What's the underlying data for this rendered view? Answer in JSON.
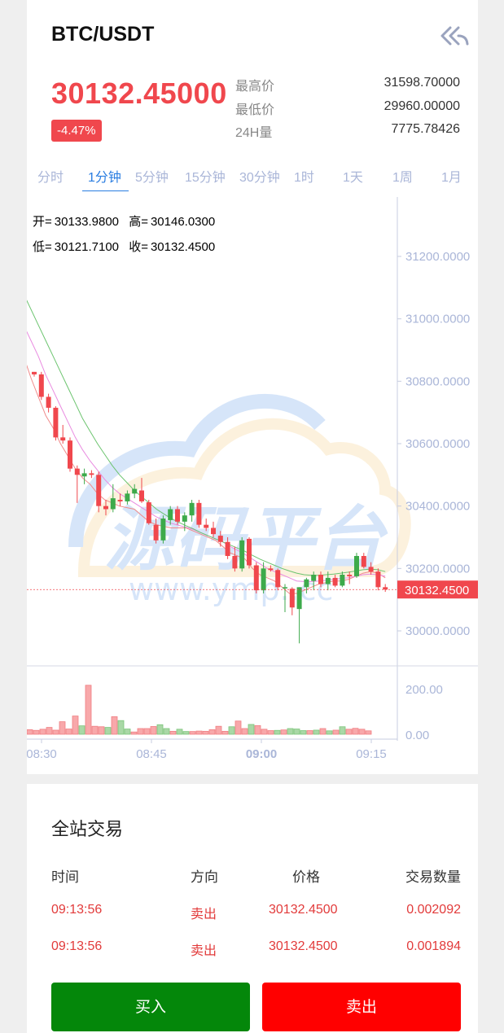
{
  "header": {
    "pair": "BTC/USDT",
    "back_icon": "double-chevron-back-icon"
  },
  "ticker": {
    "last_price": "30132.45000",
    "change": "-4.47%",
    "stats": [
      {
        "label": "最高价",
        "value": "31598.70000"
      },
      {
        "label": "最低价",
        "value": "29960.00000"
      },
      {
        "label": "24H量",
        "value": "7775.78426"
      }
    ]
  },
  "intervals": {
    "items": [
      "分时",
      "1分钟",
      "5分钟",
      "15分钟",
      "30分钟",
      "1时",
      "1天",
      "1周",
      "1月"
    ],
    "active": "1分钟"
  },
  "ohlc": {
    "open_label": "开=",
    "open": "30133.9800",
    "high_label": "高=",
    "high": "30146.0300",
    "low_label": "低=",
    "low": "30121.7100",
    "close_label": "收=",
    "close": "30132.4500"
  },
  "watermark": {
    "text": "源码平台",
    "url": "www.ymp..cc"
  },
  "colors": {
    "up": "#3daa4b",
    "down": "#f0474d",
    "accent": "#2a7de1",
    "buy": "#04870a",
    "sell": "#ff0000"
  },
  "chart_data": {
    "type": "candlestick",
    "y_ticks": [
      "31200.0000",
      "31000.0000",
      "30800.0000",
      "30600.0000",
      "30400.0000",
      "30200.0000",
      "30000.0000"
    ],
    "ylim": [
      29900,
      31380
    ],
    "last_price_label": "30132.4500",
    "last_price": 30132.45,
    "x_ticks": [
      "08:30",
      "08:45",
      "09:00",
      "09:15"
    ],
    "volume_ticks": [
      "200.00",
      "0.00"
    ],
    "volume_max": 260,
    "candles": [
      {
        "o": 30830,
        "h": 30830,
        "l": 30815,
        "c": 30822
      },
      {
        "o": 30822,
        "h": 30830,
        "l": 30740,
        "c": 30750
      },
      {
        "o": 30750,
        "h": 30760,
        "l": 30700,
        "c": 30715
      },
      {
        "o": 30715,
        "h": 30720,
        "l": 30610,
        "c": 30620
      },
      {
        "o": 30620,
        "h": 30660,
        "l": 30600,
        "c": 30610
      },
      {
        "o": 30610,
        "h": 30620,
        "l": 30510,
        "c": 30520
      },
      {
        "o": 30520,
        "h": 30530,
        "l": 30410,
        "c": 30500
      },
      {
        "o": 30495,
        "h": 30520,
        "l": 30470,
        "c": 30505
      },
      {
        "o": 30505,
        "h": 30515,
        "l": 30490,
        "c": 30500
      },
      {
        "o": 30500,
        "h": 30510,
        "l": 30380,
        "c": 30400
      },
      {
        "o": 30400,
        "h": 30420,
        "l": 30370,
        "c": 30390
      },
      {
        "o": 30390,
        "h": 30470,
        "l": 30380,
        "c": 30425
      },
      {
        "o": 30420,
        "h": 30440,
        "l": 30400,
        "c": 30415
      },
      {
        "o": 30415,
        "h": 30450,
        "l": 30405,
        "c": 30440
      },
      {
        "o": 30440,
        "h": 30470,
        "l": 30425,
        "c": 30455
      },
      {
        "o": 30450,
        "h": 30490,
        "l": 30410,
        "c": 30415
      },
      {
        "o": 30412,
        "h": 30420,
        "l": 30340,
        "c": 30345
      },
      {
        "o": 30340,
        "h": 30360,
        "l": 30280,
        "c": 30290
      },
      {
        "o": 30290,
        "h": 30370,
        "l": 30280,
        "c": 30360
      },
      {
        "o": 30355,
        "h": 30400,
        "l": 30340,
        "c": 30390
      },
      {
        "o": 30390,
        "h": 30400,
        "l": 30340,
        "c": 30350
      },
      {
        "o": 30350,
        "h": 30380,
        "l": 30320,
        "c": 30370
      },
      {
        "o": 30370,
        "h": 30420,
        "l": 30350,
        "c": 30410
      },
      {
        "o": 30410,
        "h": 30420,
        "l": 30330,
        "c": 30340
      },
      {
        "o": 30340,
        "h": 30360,
        "l": 30320,
        "c": 30330
      },
      {
        "o": 30330,
        "h": 30350,
        "l": 30300,
        "c": 30310
      },
      {
        "o": 30305,
        "h": 30320,
        "l": 30270,
        "c": 30285
      },
      {
        "o": 30285,
        "h": 30300,
        "l": 30230,
        "c": 30240
      },
      {
        "o": 30240,
        "h": 30270,
        "l": 30190,
        "c": 30200
      },
      {
        "o": 30200,
        "h": 30300,
        "l": 30190,
        "c": 30290
      },
      {
        "o": 30295,
        "h": 30300,
        "l": 30200,
        "c": 30210
      },
      {
        "o": 30210,
        "h": 30220,
        "l": 30120,
        "c": 30130
      },
      {
        "o": 30130,
        "h": 30220,
        "l": 30120,
        "c": 30200
      },
      {
        "o": 30200,
        "h": 30210,
        "l": 30190,
        "c": 30195
      },
      {
        "o": 30195,
        "h": 30200,
        "l": 30130,
        "c": 30140
      },
      {
        "o": 30140,
        "h": 30150,
        "l": 30060,
        "c": 30140
      },
      {
        "o": 30135,
        "h": 30140,
        "l": 30050,
        "c": 30075
      },
      {
        "o": 30070,
        "h": 30140,
        "l": 29960,
        "c": 30140
      },
      {
        "o": 30140,
        "h": 30170,
        "l": 30120,
        "c": 30165
      },
      {
        "o": 30160,
        "h": 30190,
        "l": 30130,
        "c": 30180
      },
      {
        "o": 30180,
        "h": 30190,
        "l": 30140,
        "c": 30150
      },
      {
        "o": 30150,
        "h": 30190,
        "l": 30130,
        "c": 30170
      },
      {
        "o": 30170,
        "h": 30180,
        "l": 30140,
        "c": 30145
      },
      {
        "o": 30145,
        "h": 30190,
        "l": 30140,
        "c": 30180
      },
      {
        "o": 30180,
        "h": 30190,
        "l": 30150,
        "c": 30175
      },
      {
        "o": 30175,
        "h": 30250,
        "l": 30170,
        "c": 30240
      },
      {
        "o": 30240,
        "h": 30250,
        "l": 30200,
        "c": 30205
      },
      {
        "o": 30205,
        "h": 30220,
        "l": 30180,
        "c": 30190
      },
      {
        "o": 30190,
        "h": 30200,
        "l": 30130,
        "c": 30140
      },
      {
        "o": 30140,
        "h": 30150,
        "l": 30125,
        "c": 30132.45
      }
    ],
    "volumes": [
      20,
      17,
      22,
      30,
      18,
      55,
      23,
      80,
      37,
      215,
      35,
      33,
      30,
      77,
      60,
      23,
      10,
      25,
      25,
      34,
      42,
      25,
      13,
      22,
      12,
      12,
      14,
      13,
      20,
      35,
      13,
      33,
      58,
      25,
      43,
      38,
      22,
      16,
      17,
      19,
      25,
      23,
      16,
      16,
      18,
      25,
      15,
      18,
      33,
      22,
      26,
      22,
      15
    ],
    "ma_lines": [
      {
        "color": "#f08a8a",
        "values": [
          30880,
          30810,
          30750,
          30690,
          30650,
          30600,
          30560,
          30520,
          30490,
          30470,
          30440,
          30420,
          30410,
          30400,
          30395,
          30390,
          30370,
          30350,
          30340,
          30335,
          30330,
          30330,
          30330,
          30320,
          30310,
          30300,
          30290,
          30270,
          30250,
          30240,
          30230,
          30200,
          30180,
          30170,
          30160,
          30140,
          30120,
          30120,
          30130,
          30140,
          30150,
          30155,
          30160,
          30160,
          30165,
          30175,
          30185,
          30190,
          30185,
          30170
        ]
      },
      {
        "color": "#e98be0",
        "values": [
          30980,
          30930,
          30880,
          30820,
          30770,
          30720,
          30670,
          30620,
          30580,
          30545,
          30515,
          30485,
          30460,
          30440,
          30425,
          30410,
          30395,
          30380,
          30365,
          30355,
          30345,
          30338,
          30332,
          30325,
          30315,
          30305,
          30295,
          30285,
          30270,
          30258,
          30245,
          30230,
          30215,
          30200,
          30190,
          30180,
          30170,
          30160,
          30158,
          30158,
          30160,
          30162,
          30165,
          30168,
          30170,
          30175,
          30180,
          30182,
          30180,
          30175
        ]
      },
      {
        "color": "#6cc46f",
        "values": [
          31080,
          31030,
          30980,
          30930,
          30880,
          30830,
          30780,
          30730,
          30680,
          30640,
          30600,
          30565,
          30530,
          30500,
          30475,
          30450,
          30430,
          30410,
          30390,
          30375,
          30360,
          30348,
          30337,
          30327,
          30315,
          30305,
          30295,
          30285,
          30275,
          30265,
          30255,
          30242,
          30230,
          30220,
          30210,
          30200,
          30192,
          30185,
          30180,
          30178,
          30178,
          30180,
          30182,
          30185,
          30188,
          30192,
          30196,
          30198,
          30196,
          30190
        ]
      }
    ]
  },
  "trades": {
    "title": "全站交易",
    "headers": [
      "时间",
      "方向",
      "价格",
      "交易数量"
    ],
    "rows": [
      {
        "time": "09:13:56",
        "side": "卖出",
        "price": "30132.4500",
        "amount": "0.002092"
      },
      {
        "time": "09:13:56",
        "side": "卖出",
        "price": "30132.4500",
        "amount": "0.001894"
      }
    ]
  },
  "actions": {
    "buy_label": "买入",
    "sell_label": "卖出"
  }
}
